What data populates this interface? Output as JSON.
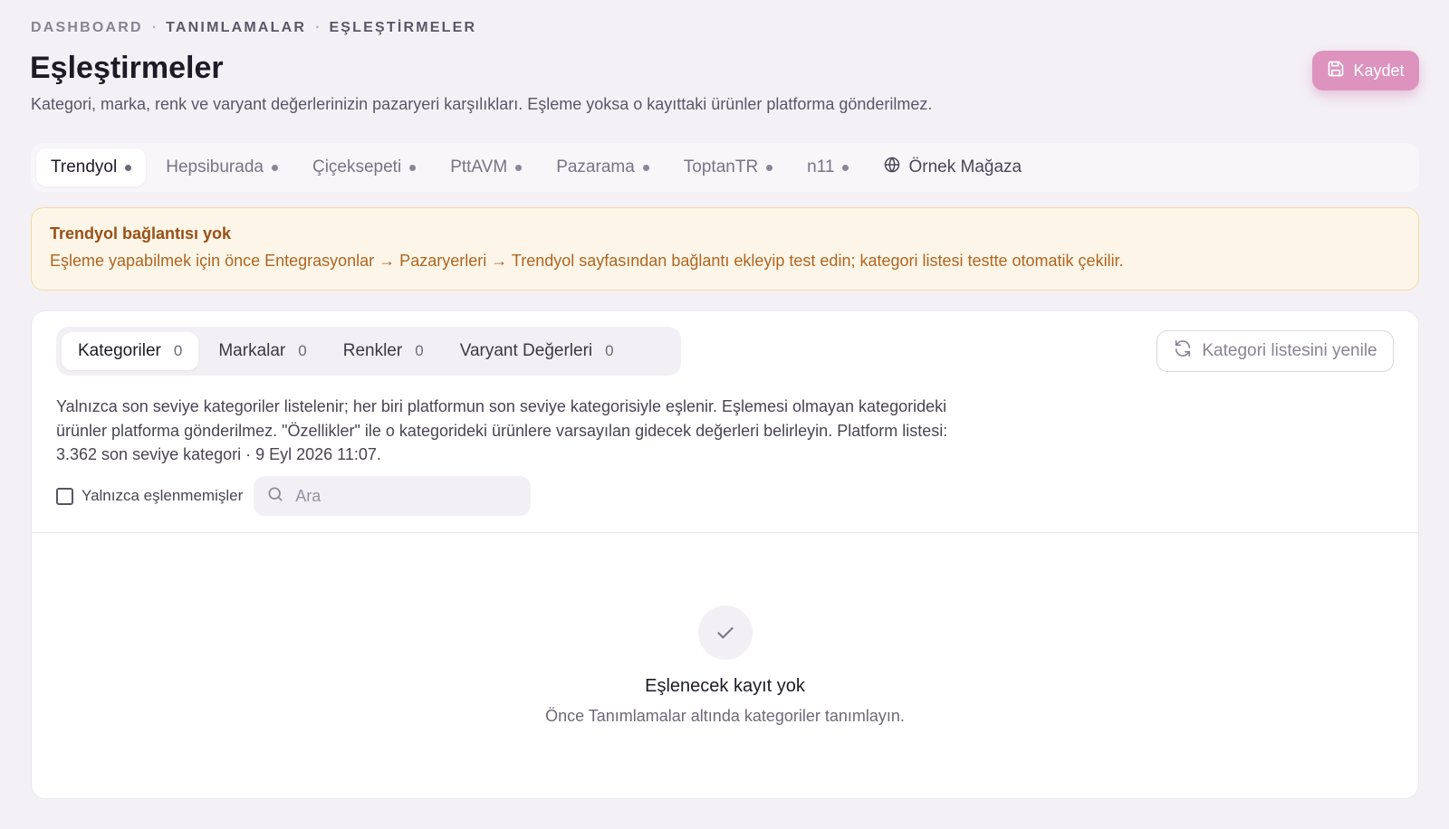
{
  "breadcrumb": {
    "items": [
      "DASHBOARD",
      "TANIMLAMALAR",
      "EŞLEŞTİRMELER"
    ],
    "separator": "·"
  },
  "header": {
    "title": "Eşleştirmeler",
    "description": "Kategori, marka, renk ve varyant değerlerinizin pazaryeri karşılıkları. Eşleme yoksa o kayıttaki ürünler platforma gönderilmez.",
    "save_label": "Kaydet",
    "save_icon": "save-icon",
    "accent_color": "#dd93be"
  },
  "marketplace_tabs": [
    {
      "label": "Trendyol",
      "active": true
    },
    {
      "label": "Hepsiburada",
      "active": false
    },
    {
      "label": "Çiçeksepeti",
      "active": false
    },
    {
      "label": "PttAVM",
      "active": false
    },
    {
      "label": "Pazarama",
      "active": false
    },
    {
      "label": "ToptanTR",
      "active": false
    },
    {
      "label": "n11",
      "active": false
    }
  ],
  "store_tab": {
    "label": "Örnek Mağaza",
    "icon": "globe-icon"
  },
  "alert": {
    "title": "Trendyol bağlantısı yok",
    "text": "Eşleme yapabilmek için önce Entegrasyonlar → Pazaryerleri → Trendyol sayfasından bağlantı ekleyip test edin; kategori listesi testte otomatik çekilir.",
    "color": "#b06420"
  },
  "sub_tabs": [
    {
      "label": "Kategoriler",
      "count": "0",
      "active": true
    },
    {
      "label": "Markalar",
      "count": "0",
      "active": false
    },
    {
      "label": "Renkler",
      "count": "0",
      "active": false
    },
    {
      "label": "Varyant Değerleri",
      "count": "0",
      "active": false
    }
  ],
  "refresh_label": "Kategori listesini yenile",
  "info": {
    "line1": "Yalnızca son seviye kategoriler listelenir; her biri platformun son seviye kategorisiyle eşlenir. Eşlemesi olmayan kategorideki",
    "line2": "ürünler platforma gönderilmez. \"Özellikler\" ile o kategorideki ürünlere varsayılan gidecek değerleri belirleyin. Platform listesi:",
    "line3": "3.362 son seviye kategori · 9 Eyl 2026 11:07."
  },
  "filter": {
    "checkbox_label": "Yalnızca eşlenmemişler",
    "checked": false,
    "search_placeholder": "Ara",
    "search_value": ""
  },
  "empty": {
    "icon": "check-icon",
    "title": "Eşlenecek kayıt yok",
    "subtitle": "Önce Tanımlamalar altında kategoriler tanımlayın."
  }
}
